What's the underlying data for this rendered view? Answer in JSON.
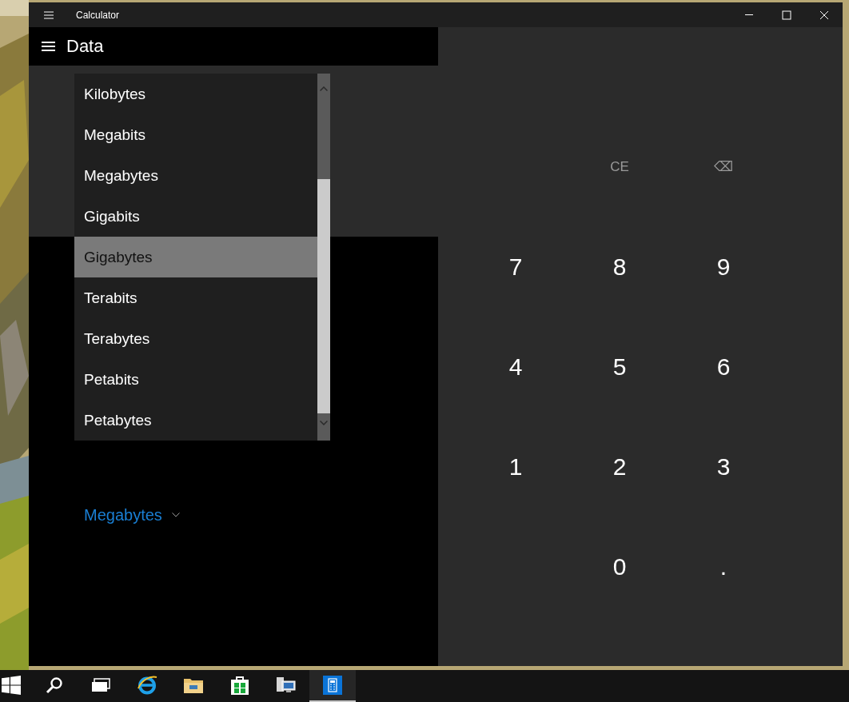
{
  "window": {
    "title": "Calculator"
  },
  "header": {
    "title": "Data"
  },
  "converter": {
    "output_unit": "Megabytes"
  },
  "unit_dropdown": {
    "items": [
      {
        "label": "Kilobytes",
        "selected": false
      },
      {
        "label": "Megabits",
        "selected": false
      },
      {
        "label": "Megabytes",
        "selected": false
      },
      {
        "label": "Gigabits",
        "selected": false
      },
      {
        "label": "Gigabytes",
        "selected": true
      },
      {
        "label": "Terabits",
        "selected": false
      },
      {
        "label": "Terabytes",
        "selected": false
      },
      {
        "label": "Petabits",
        "selected": false
      },
      {
        "label": "Petabytes",
        "selected": false
      }
    ]
  },
  "keypad": {
    "rows": [
      {
        "keys": [
          {
            "label": "CE",
            "kind": "function"
          },
          {
            "label": "⌫",
            "kind": "function"
          }
        ]
      },
      {
        "keys": [
          {
            "label": "7",
            "kind": "digit"
          },
          {
            "label": "8",
            "kind": "digit"
          },
          {
            "label": "9",
            "kind": "digit"
          }
        ]
      },
      {
        "keys": [
          {
            "label": "4",
            "kind": "digit"
          },
          {
            "label": "5",
            "kind": "digit"
          },
          {
            "label": "6",
            "kind": "digit"
          }
        ]
      },
      {
        "keys": [
          {
            "label": "1",
            "kind": "digit"
          },
          {
            "label": "2",
            "kind": "digit"
          },
          {
            "label": "3",
            "kind": "digit"
          }
        ]
      },
      {
        "keys": [
          {
            "label": "0",
            "kind": "digit"
          },
          {
            "label": ".",
            "kind": "digit"
          }
        ]
      }
    ]
  },
  "taskbar": {
    "items": [
      {
        "kind": "start",
        "selected": false
      },
      {
        "kind": "search",
        "selected": false
      },
      {
        "kind": "taskview",
        "selected": false
      },
      {
        "kind": "browser",
        "selected": false
      },
      {
        "kind": "folder",
        "selected": false
      },
      {
        "kind": "store",
        "selected": false
      },
      {
        "kind": "computer",
        "selected": false
      },
      {
        "kind": "calculator",
        "selected": true
      }
    ]
  }
}
